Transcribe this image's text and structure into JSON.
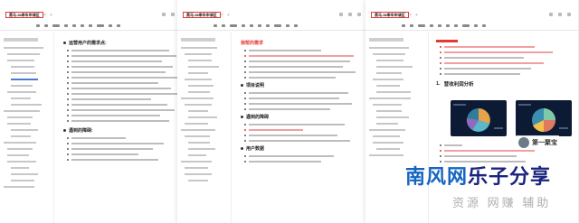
{
  "windows": [
    {
      "doc_badge": "黑马-58审车申请区"
    },
    {
      "doc_badge": "黑马-58审车申请区"
    },
    {
      "doc_badge": "黑马-58审车申请区"
    }
  ],
  "panel1": {
    "headings": [
      "运营用户的需求点:",
      "遇到的障碍:"
    ]
  },
  "panel2": {
    "red_heading": "我帮的需求",
    "headings": [
      "项目说明",
      "遇到的障碍",
      "用户数据"
    ]
  },
  "panel3": {
    "report_number": "1.",
    "report_title": "营收利润分析"
  },
  "watermark_badge": {
    "text": "第一聚宝"
  },
  "banner": {
    "main_part1": "南风网",
    "main_part2": "乐子分享",
    "subtitle": "资源 网赚 辅助"
  },
  "colors": {
    "accent_red": "#e53935",
    "banner_blue": "#1565c0",
    "banner_dark": "#1a237e",
    "chart_bg": "#0d1a33"
  }
}
